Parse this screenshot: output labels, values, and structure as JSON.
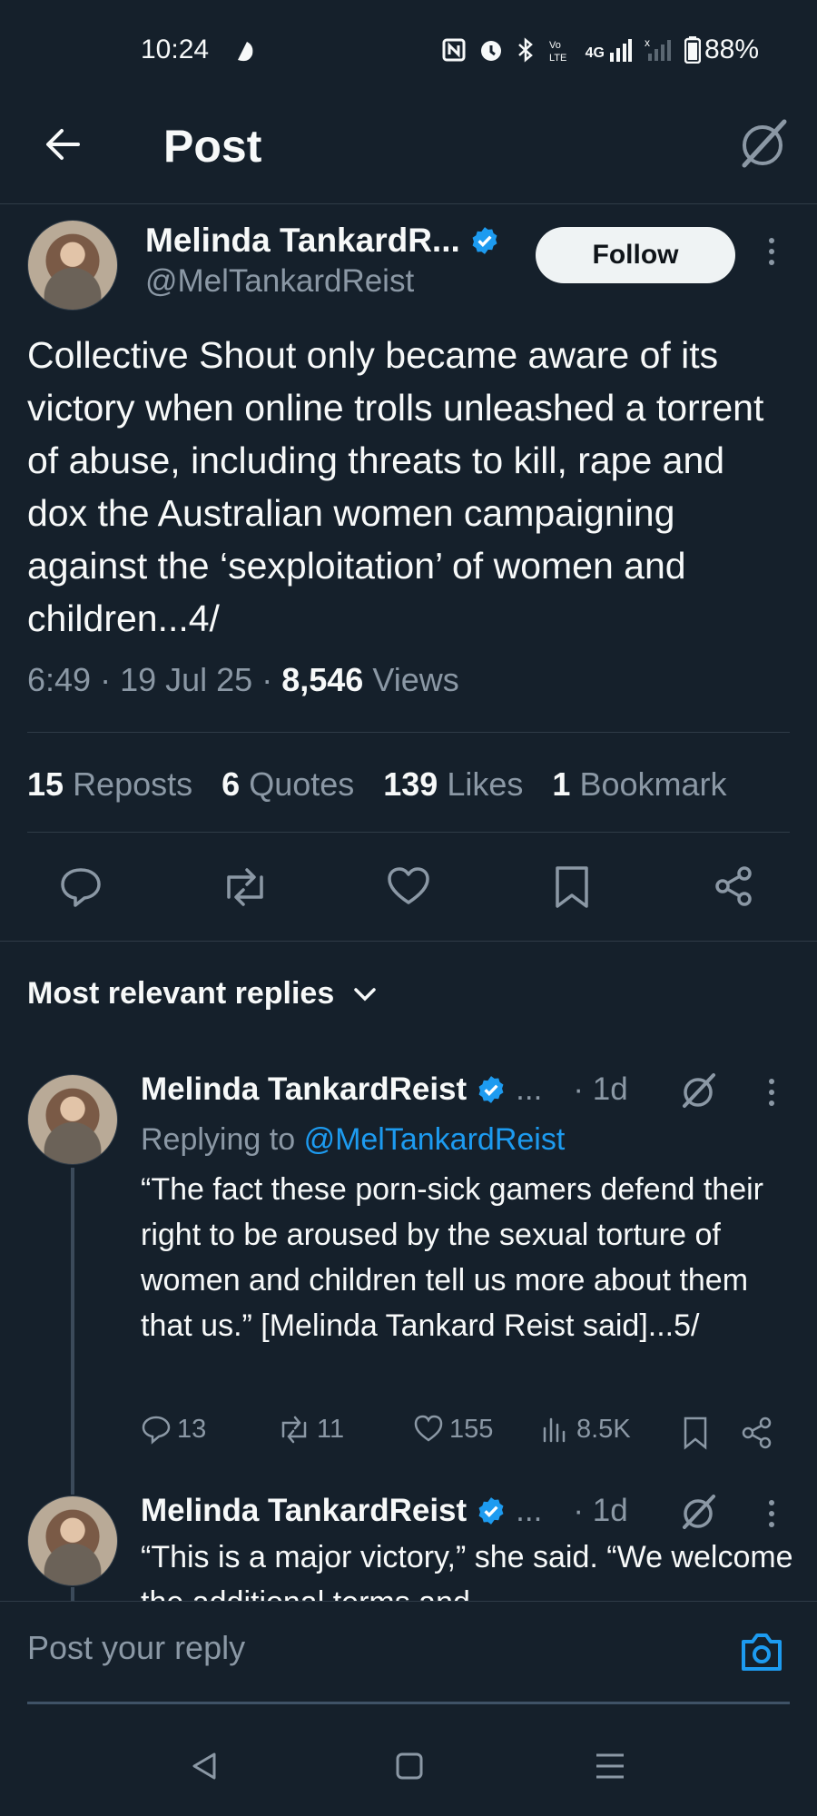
{
  "status_bar": {
    "time": "10:24",
    "battery": "88%",
    "network": "4G"
  },
  "header": {
    "title": "Post"
  },
  "post": {
    "author_name": "Melinda TankardR...",
    "handle": "@MelTankardReist",
    "follow_label": "Follow",
    "text": "Collective Shout only became aware of its victory when online trolls unleashed a torrent of abuse, including threats to kill, rape and dox the Australian women campaigning against the ‘sexploitation’ of women and children...4/",
    "time": "6:49",
    "date": "19 Jul 25",
    "views_count": "8,546",
    "views_label": "Views",
    "stats": [
      {
        "count": "15",
        "label": "Reposts"
      },
      {
        "count": "6",
        "label": "Quotes"
      },
      {
        "count": "139",
        "label": "Likes"
      },
      {
        "count": "1",
        "label": "Bookmark"
      }
    ]
  },
  "replies_section": {
    "title": "Most relevant replies"
  },
  "replies": [
    {
      "author_name": "Melinda TankardReist",
      "ellipsis": "...",
      "age": "· 1d",
      "replying_prefix": "Replying to",
      "replying_handle": "@MelTankardReist",
      "text": "“The fact these porn-sick gamers defend their right to be aroused by the sexual torture of women and children tell us more about them that us.” [Melinda Tankard Reist said]...5/",
      "replies_count": "13",
      "reposts_count": "11",
      "likes_count": "155",
      "views_count": "8.5K"
    },
    {
      "author_name": "Melinda TankardReist",
      "ellipsis": "...",
      "age": "· 1d",
      "text": "“This is a major victory,” she said. “We welcome the additional terms and"
    }
  ],
  "composer": {
    "placeholder": "Post your reply"
  },
  "colors": {
    "background": "#15202b",
    "accent": "#1d9bf0",
    "muted": "#8b98a5"
  }
}
